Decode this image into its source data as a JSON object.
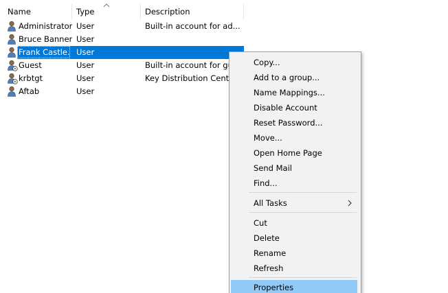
{
  "columns": {
    "name": "Name",
    "type": "Type",
    "description": "Description"
  },
  "rows": [
    {
      "name": "Administrator",
      "type": "User",
      "description": "Built-in account for ad...",
      "icon": "user-icon"
    },
    {
      "name": "Bruce Banner.",
      "type": "User",
      "description": "",
      "icon": "user-icon"
    },
    {
      "name": "Frank Castle.",
      "type": "User",
      "description": "",
      "icon": "user-icon",
      "selected": true
    },
    {
      "name": "Guest",
      "type": "User",
      "description": "Built-in account for gue",
      "icon": "disabled-user-icon"
    },
    {
      "name": "krbtgt",
      "type": "User",
      "description": "Key Distribution Center",
      "icon": "disabled-user-icon"
    },
    {
      "name": "Aftab",
      "type": "User",
      "description": "",
      "icon": "user-icon"
    }
  ],
  "context_menu": {
    "items": [
      {
        "label": "Copy..."
      },
      {
        "label": "Add to a group..."
      },
      {
        "label": "Name Mappings..."
      },
      {
        "label": "Disable Account"
      },
      {
        "label": "Reset Password..."
      },
      {
        "label": "Move..."
      },
      {
        "label": "Open Home Page"
      },
      {
        "label": "Send Mail"
      },
      {
        "label": "Find..."
      },
      {
        "label": "All Tasks",
        "submenu": true
      },
      {
        "label": "Cut"
      },
      {
        "label": "Delete"
      },
      {
        "label": "Rename"
      },
      {
        "label": "Refresh"
      },
      {
        "label": "Properties",
        "highlighted": true
      }
    ]
  },
  "colors": {
    "selection": "#0078d7",
    "menu_highlight": "#91c9f7",
    "menu_background": "#f2f2f2"
  }
}
